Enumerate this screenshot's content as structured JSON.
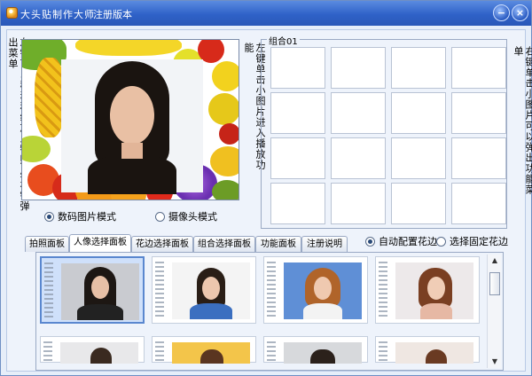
{
  "window": {
    "title": "大头贴制作大师",
    "edition": "注册版本",
    "minimize_glyph": "−",
    "close_glyph": "×"
  },
  "left_hint": "左键可以移动和缩放人物照片,右键弹出菜单",
  "middle_hint": "左键单击小图片进入播放功能",
  "right_hint": "右键单击小图片可以弹出功能菜单",
  "combo": {
    "legend": "组合01",
    "rows": 4,
    "cols": 4
  },
  "capture_mode": {
    "options": [
      "数码图片模式",
      "摄像头模式"
    ],
    "selected": 0
  },
  "frame_mode": {
    "options": [
      "自动配置花边",
      "选择固定花边"
    ],
    "selected": 0
  },
  "tabs": {
    "labels": [
      "拍照面板",
      "人像选择面板",
      "花边选择面板",
      "组合选择面板",
      "功能面板",
      "注册说明"
    ],
    "active": 1
  },
  "thumbnails": {
    "rows_visible": 2,
    "selected": 0,
    "count": 8
  },
  "colors": {
    "title_bar": "#2f62c8",
    "window_bg": "#e6eef9",
    "selected_thumb": "#cfe0fa"
  },
  "icons": {
    "app": "app-icon",
    "minimize": "minimize-icon",
    "close": "close-icon",
    "scroll_up": "scroll-up-arrow-icon",
    "scroll_down": "scroll-down-arrow-icon"
  }
}
